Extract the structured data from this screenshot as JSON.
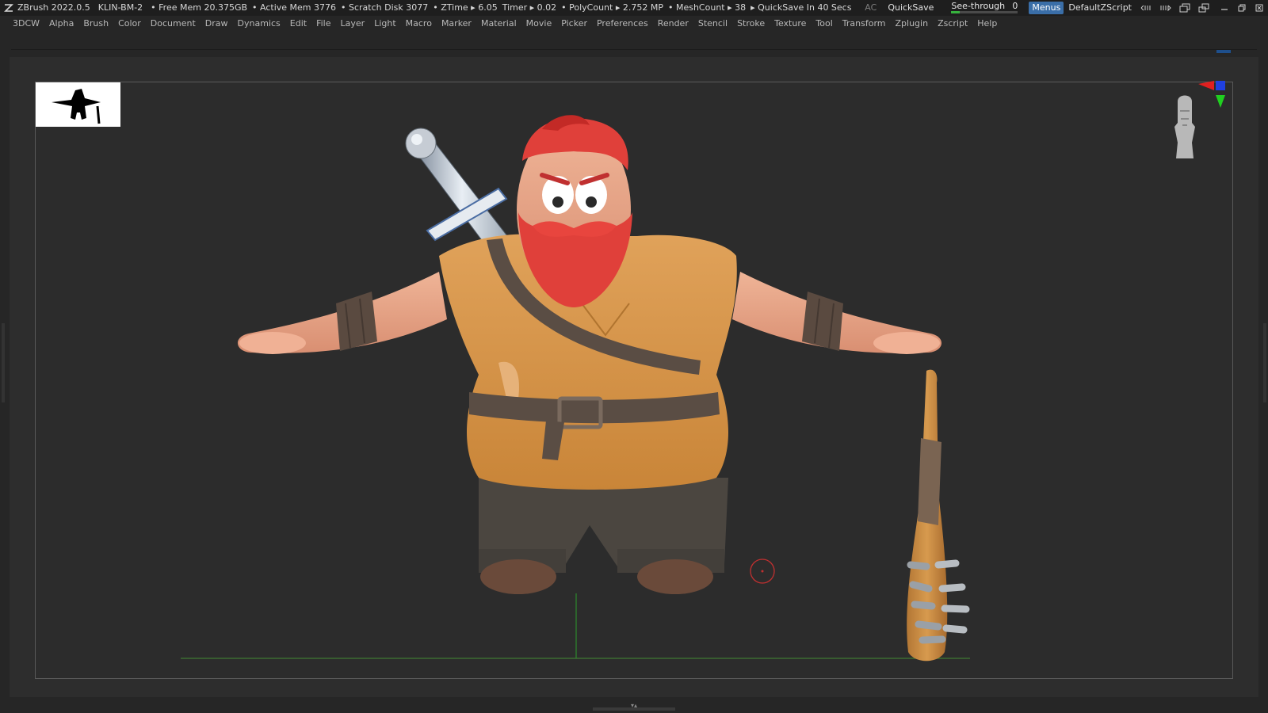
{
  "titlebar": {
    "app": "ZBrush 2022.0.5",
    "project": "KLIN-BM-2",
    "free_mem": "• Free Mem 20.375GB",
    "active_mem": "• Active Mem 3776",
    "scratch_disk": "• Scratch Disk 3077",
    "ztime": "• ZTime ▸ 6.05",
    "timer": "Timer ▸ 0.02",
    "polycount": "• PolyCount ▸ 2.752 MP",
    "meshcount": "• MeshCount ▸ 38",
    "quicksave_in": "▸ QuickSave In 40 Secs",
    "ac": "AC",
    "quicksave": "QuickSave",
    "see_through_label": "See-through",
    "see_through_value": "0",
    "see_through_fraction": 0.12,
    "menus": "Menus",
    "default_zscript": "DefaultZScript"
  },
  "menubar": {
    "items": [
      "3DCW",
      "Alpha",
      "Brush",
      "Color",
      "Document",
      "Draw",
      "Dynamics",
      "Edit",
      "File",
      "Layer",
      "Light",
      "Macro",
      "Marker",
      "Material",
      "Movie",
      "Picker",
      "Preferences",
      "Render",
      "Stencil",
      "Stroke",
      "Texture",
      "Tool",
      "Transform",
      "Zplugin",
      "Zscript",
      "Help"
    ]
  },
  "colors": {
    "accent_blue": "#3a6ea8",
    "see_through_green": "#37b33e",
    "shirt": "#d9974a",
    "skin": "#e6a184",
    "beard": "#e0403a",
    "leather": "#5a4a40",
    "pants": "#4a4540"
  }
}
